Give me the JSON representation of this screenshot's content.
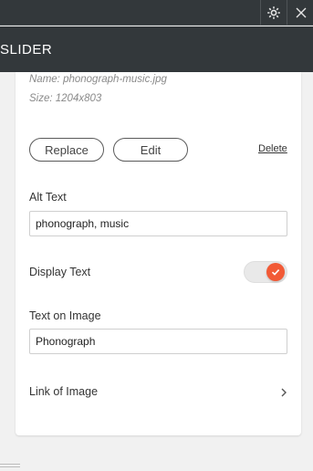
{
  "header": {
    "settings_icon": "gear-icon",
    "close_icon": "close-icon",
    "title": "SLIDER"
  },
  "image": {
    "name": "Name: phonograph-music.jpg",
    "size": "Size: 1204x803",
    "replace_label": "Replace",
    "edit_label": "Edit",
    "delete_label": "Delete"
  },
  "alt_text": {
    "label": "Alt Text",
    "value": "phonograph, music"
  },
  "display_text": {
    "label": "Display Text",
    "enabled": true,
    "toggle_color": "#f25a36"
  },
  "text_on_image": {
    "label": "Text on Image",
    "value": "Phonograph"
  },
  "link_of_image": {
    "label": "Link of Image",
    "chevron_icon": "chevron-right-icon"
  }
}
